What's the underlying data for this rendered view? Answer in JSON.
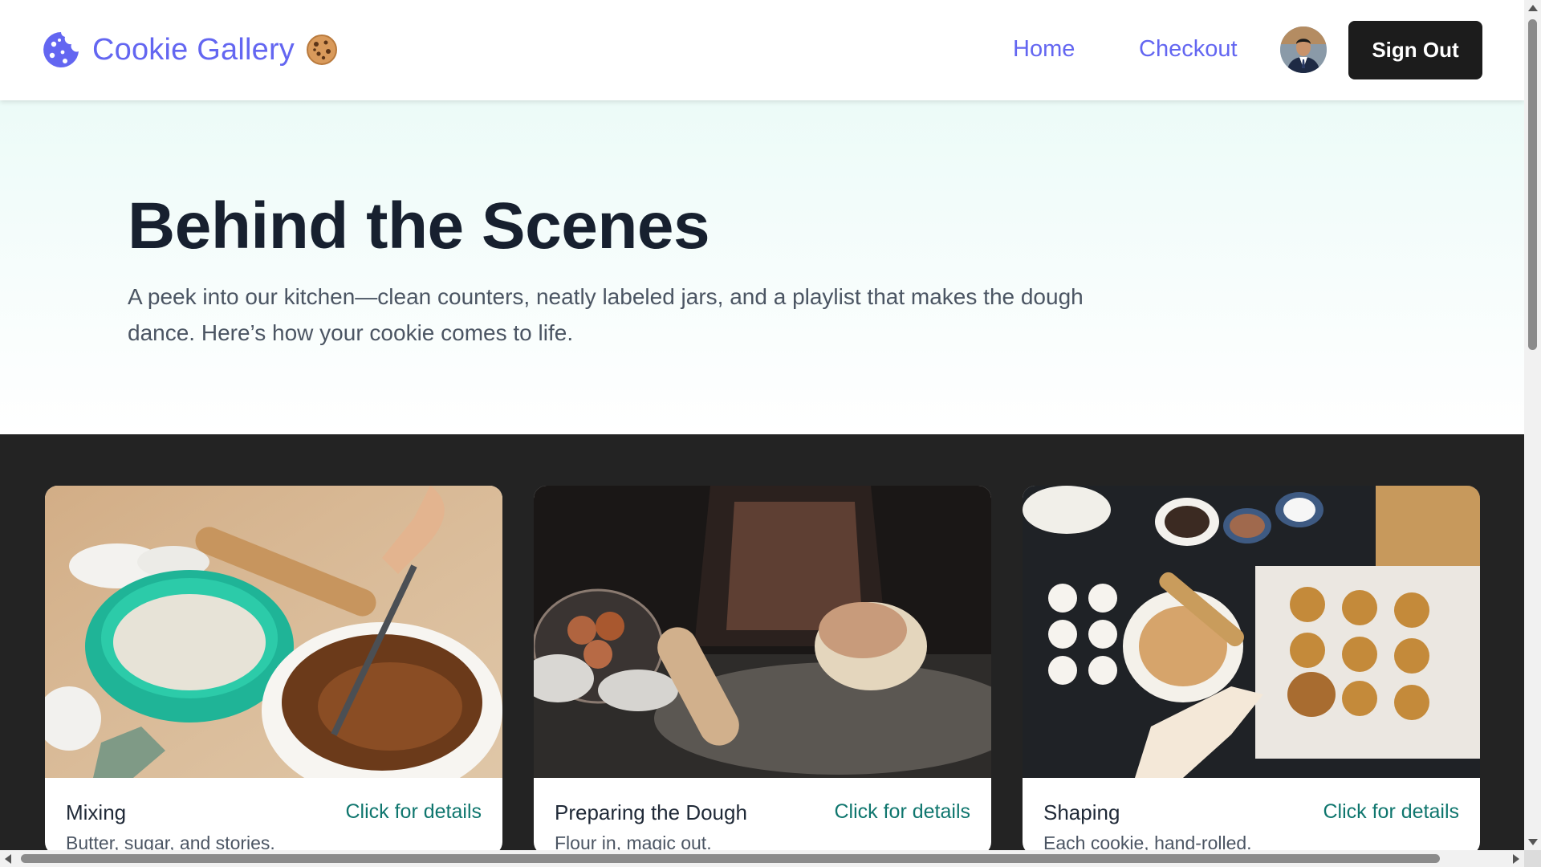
{
  "header": {
    "brand_name": "Cookie Gallery",
    "brand_logo_icon": "cookie-bite-icon",
    "brand_emoji_icon": "cookie-emoji-icon",
    "nav": {
      "home": "Home",
      "checkout": "Checkout"
    },
    "avatar_alt": "user-avatar",
    "signout_label": "Sign Out"
  },
  "hero": {
    "title": "Behind the Scenes",
    "subtitle": "A peek into our kitchen—clean counters, neatly labeled jars, and a playlist that makes the dough dance. Here’s how your cookie comes to life."
  },
  "steps": [
    {
      "title": "Mixing",
      "link": "Click for details",
      "desc": "Butter, sugar, and stories.",
      "image": "mixing-bowl-photo"
    },
    {
      "title": "Preparing the Dough",
      "link": "Click for details",
      "desc": "Flour in, magic out.",
      "image": "kneading-dough-photo"
    },
    {
      "title": "Shaping",
      "link": "Click for details",
      "desc": "Each cookie, hand-rolled.",
      "image": "shaping-cookies-photo"
    }
  ],
  "colors": {
    "brand": "#6366f1",
    "link_teal": "#0f766e",
    "dark_section": "#232323",
    "title": "#17202f",
    "button_bg": "#1c1c1c"
  }
}
